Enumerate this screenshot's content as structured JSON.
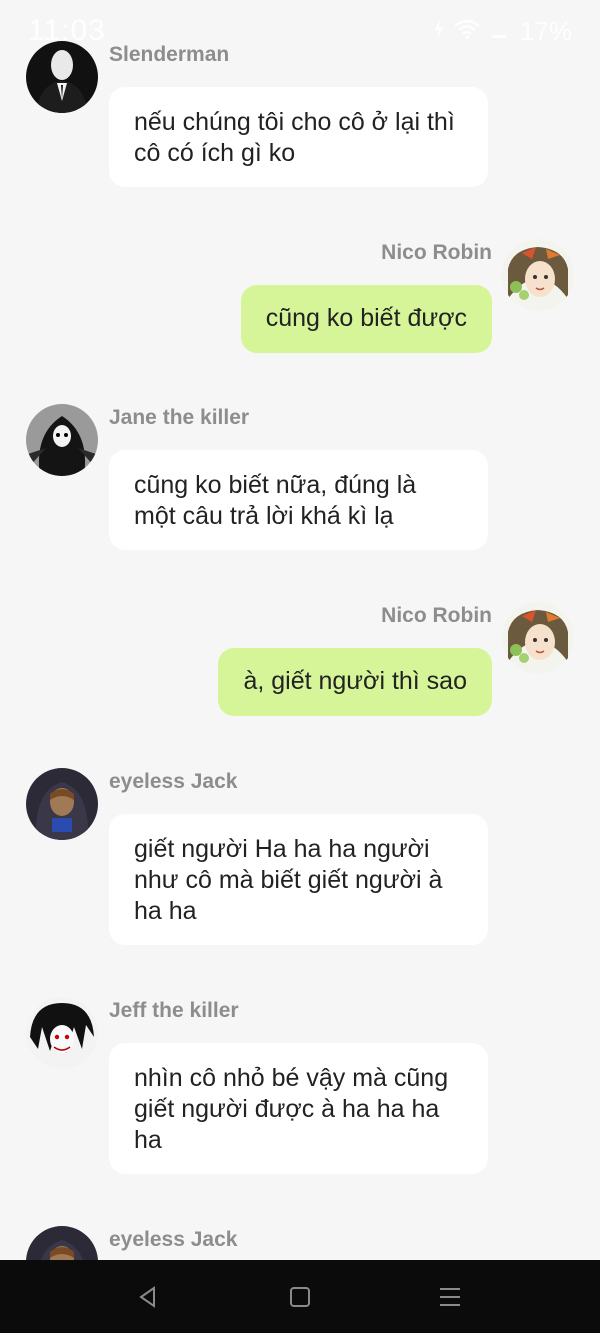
{
  "status_bar": {
    "time": "11:03",
    "battery": "17%",
    "icons": [
      "charging-icon",
      "wifi-icon",
      "signal-icon"
    ]
  },
  "messages": [
    {
      "side": "left",
      "sender": "Slenderman",
      "avatar": "slenderman-avatar",
      "text": "nếu chúng tôi cho cô ở lại thì cô có ích gì ko"
    },
    {
      "side": "right",
      "sender": "Nico Robin",
      "avatar": "nico-robin-avatar",
      "text": "cũng ko biết được"
    },
    {
      "side": "left",
      "sender": "Jane the killer",
      "avatar": "jane-avatar",
      "text": "cũng ko biết nữa, đúng là một câu trả lời khá kì lạ"
    },
    {
      "side": "right",
      "sender": "Nico Robin",
      "avatar": "nico-robin-avatar",
      "text": "à, giết người thì sao"
    },
    {
      "side": "left",
      "sender": "eyeless Jack",
      "avatar": "eyeless-jack-avatar",
      "text": "giết người Ha ha ha người như cô mà biết giết người à ha ha"
    },
    {
      "side": "left",
      "sender": "Jeff the killer",
      "avatar": "jeff-avatar",
      "text": "nhìn cô nhỏ bé vậy mà cũng giết người được à ha ha ha ha"
    },
    {
      "side": "left",
      "sender": "eyeless Jack",
      "avatar": "eyeless-jack-avatar",
      "text": ""
    }
  ],
  "colors": {
    "background": "#f6f6f6",
    "left_bubble": "#ffffff",
    "right_bubble": "#d6f598",
    "sender_name": "#8d8d8d",
    "nav_bar": "#0b0b0b"
  },
  "nav_bar": {
    "buttons": [
      "back-icon",
      "home-icon",
      "menu-icon"
    ]
  }
}
